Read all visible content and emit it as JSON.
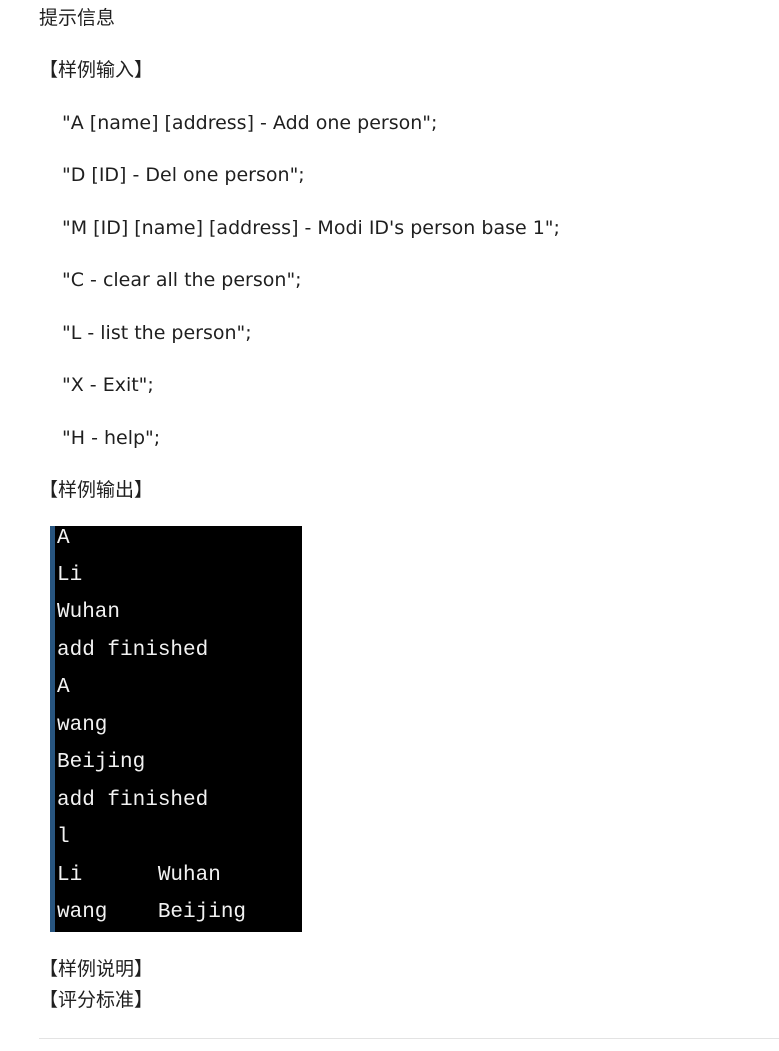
{
  "hint_title": "提示信息",
  "sample_input": {
    "heading": "【样例输入】",
    "lines": [
      "\"A [name] [address] - Add one person\";",
      "\"D [ID] - Del one person\";",
      "\"M [ID] [name] [address] - Modi ID's person base 1\";",
      "\"C - clear all the person\";",
      "\"L - list the person\";",
      "\"X - Exit\";",
      "\"H - help\";"
    ]
  },
  "sample_output": {
    "heading": "【样例输出】",
    "console_lines": [
      "A",
      "Li",
      "Wuhan",
      "add finished",
      "A",
      "wang",
      "Beijing",
      "add finished",
      "l",
      "Li      Wuhan",
      "wang    Beijing"
    ]
  },
  "sample_explanation": {
    "heading": "【样例说明】"
  },
  "scoring_criteria": {
    "heading": "【评分标准】"
  }
}
